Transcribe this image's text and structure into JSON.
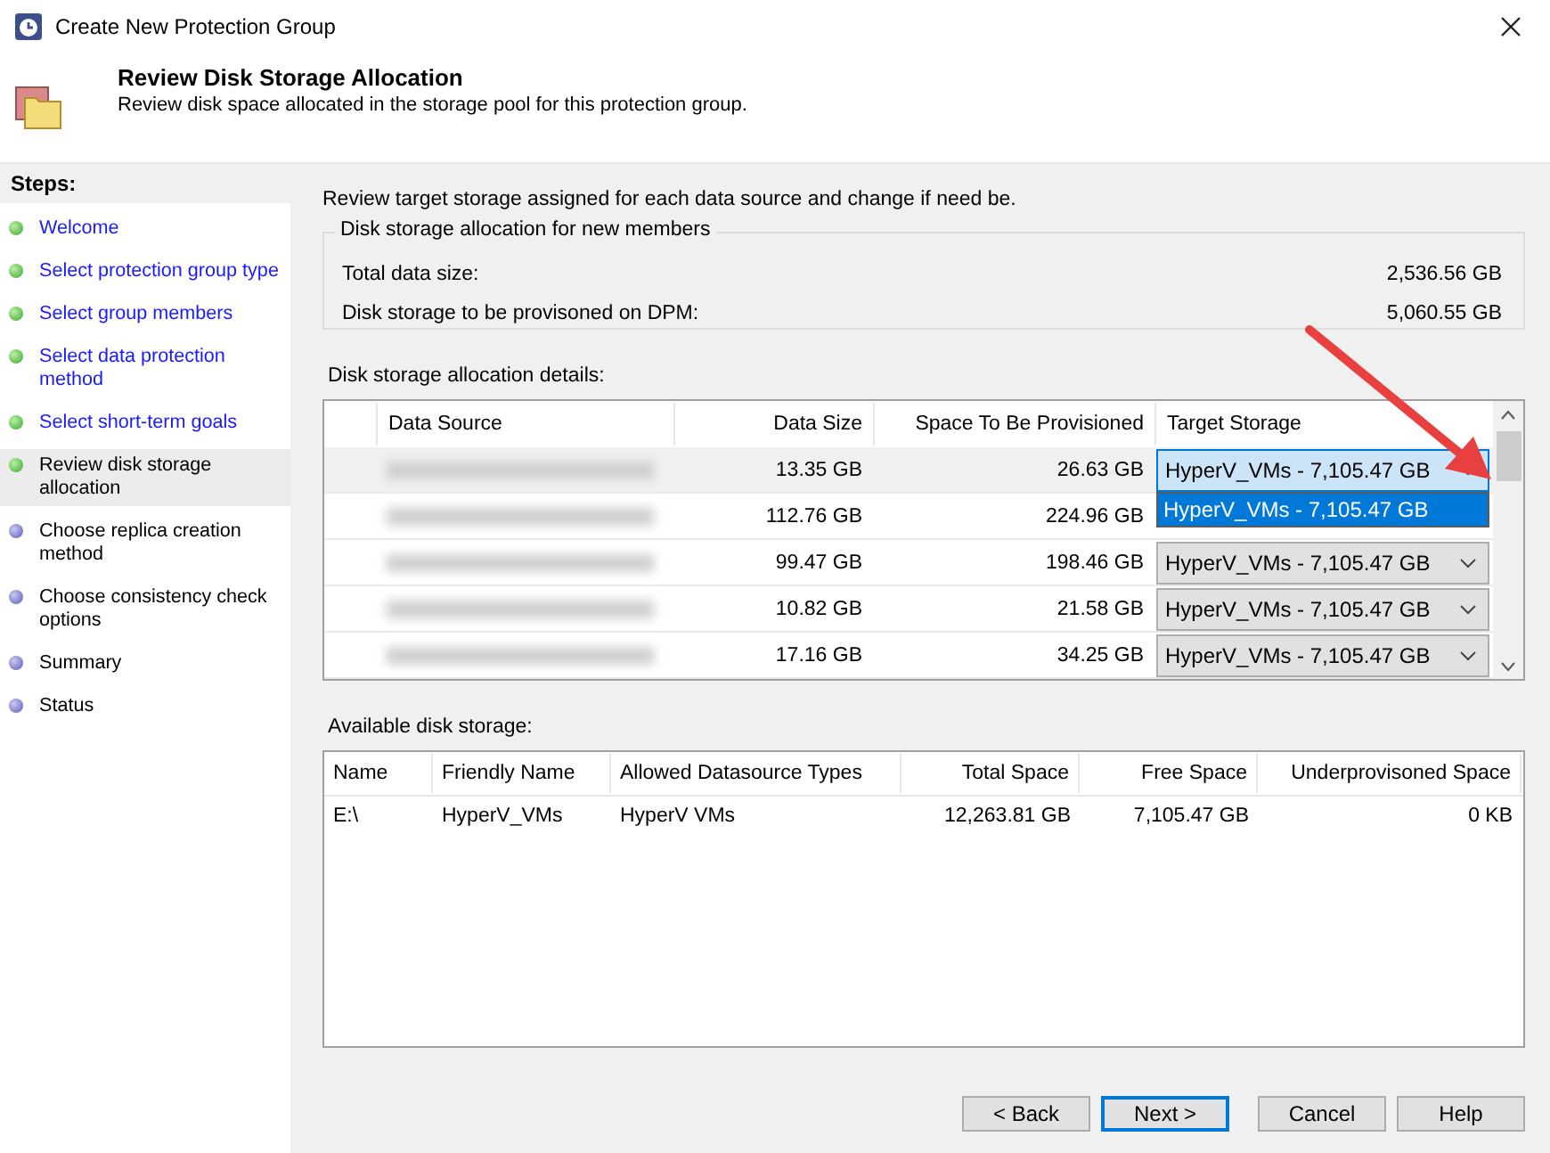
{
  "window": {
    "title": "Create New Protection Group"
  },
  "header": {
    "title": "Review Disk Storage Allocation",
    "subtitle": "Review disk space allocated in the storage pool for this protection group."
  },
  "steps": {
    "title": "Steps:",
    "items": [
      {
        "label": "Welcome",
        "completed": true,
        "selected": false
      },
      {
        "label": "Select protection group type",
        "completed": true,
        "selected": false
      },
      {
        "label": "Select group members",
        "completed": true,
        "selected": false
      },
      {
        "label": "Select data protection method",
        "completed": true,
        "selected": false
      },
      {
        "label": "Select short-term goals",
        "completed": true,
        "selected": false
      },
      {
        "label": "Review disk storage allocation",
        "completed": true,
        "selected": true
      },
      {
        "label": "Choose replica creation method",
        "completed": false,
        "selected": false
      },
      {
        "label": "Choose consistency check options",
        "completed": false,
        "selected": false
      },
      {
        "label": "Summary",
        "completed": false,
        "selected": false
      },
      {
        "label": "Status",
        "completed": false,
        "selected": false
      }
    ]
  },
  "intro": "Review target storage assigned for each data source and change if need be.",
  "summary_group": {
    "title": "Disk storage allocation for new members",
    "rows": [
      {
        "label": "Total data size:",
        "value": "2,536.56 GB"
      },
      {
        "label": "Disk storage to be provisoned on DPM:",
        "value": "5,060.55 GB"
      }
    ]
  },
  "allocation_table": {
    "label": "Disk storage allocation details:",
    "columns": [
      "Data Source",
      "Data Size",
      "Space To Be Provisioned",
      "Target Storage"
    ],
    "rows": [
      {
        "data_size": "13.35 GB",
        "space": "26.63 GB",
        "target": "HyperV_VMs - 7,105.47 GB",
        "selected": true,
        "open": true,
        "options": [
          "HyperV_VMs - 7,105.47 GB"
        ]
      },
      {
        "data_size": "112.76 GB",
        "space": "224.96 GB",
        "selected": false,
        "open": false
      },
      {
        "data_size": "99.47 GB",
        "space": "198.46 GB",
        "target": "HyperV_VMs - 7,105.47 GB",
        "selected": false,
        "open": false
      },
      {
        "data_size": "10.82 GB",
        "space": "21.58 GB",
        "target": "HyperV_VMs - 7,105.47 GB",
        "selected": false,
        "open": false
      },
      {
        "data_size": "17.16 GB",
        "space": "34.25 GB",
        "target": "HyperV_VMs - 7,105.47 GB",
        "selected": false,
        "open": false
      }
    ]
  },
  "storage_table": {
    "label": "Available disk storage:",
    "columns": [
      "Name",
      "Friendly Name",
      "Allowed Datasource Types",
      "Total Space",
      "Free Space",
      "Underprovisoned Space"
    ],
    "rows": [
      [
        "E:\\",
        "HyperV_VMs",
        "HyperV VMs",
        "12,263.81 GB",
        "7,105.47 GB",
        "0 KB"
      ]
    ]
  },
  "buttons": [
    {
      "label": "< Back",
      "default": false
    },
    {
      "label": "Next >",
      "default": true
    },
    {
      "label": "Cancel",
      "default": false
    },
    {
      "label": "Help",
      "default": false
    }
  ]
}
